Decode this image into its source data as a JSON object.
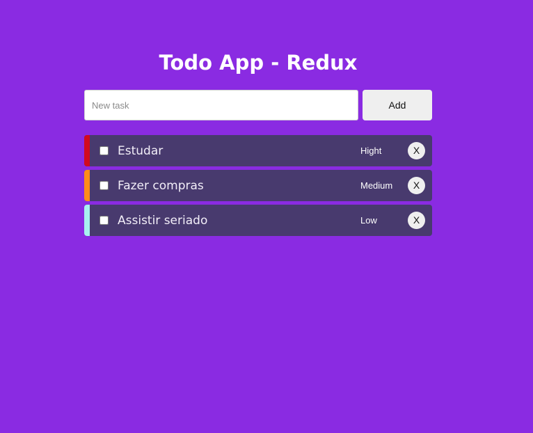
{
  "header": {
    "title": "Todo App - Redux"
  },
  "form": {
    "input_placeholder": "New task",
    "input_value": "",
    "add_label": "Add"
  },
  "colors": {
    "background": "#8a2be2",
    "task_background": "#483a6e",
    "priority_high": "#d10a1f",
    "priority_medium": "#ff8c1a",
    "priority_low": "#a8f0f0"
  },
  "tasks": [
    {
      "text": "Estudar",
      "priority": "Hight",
      "checked": false,
      "delete_label": "X"
    },
    {
      "text": "Fazer compras",
      "priority": "Medium",
      "checked": false,
      "delete_label": "X"
    },
    {
      "text": "Assistir seriado",
      "priority": "Low",
      "checked": false,
      "delete_label": "X"
    }
  ]
}
